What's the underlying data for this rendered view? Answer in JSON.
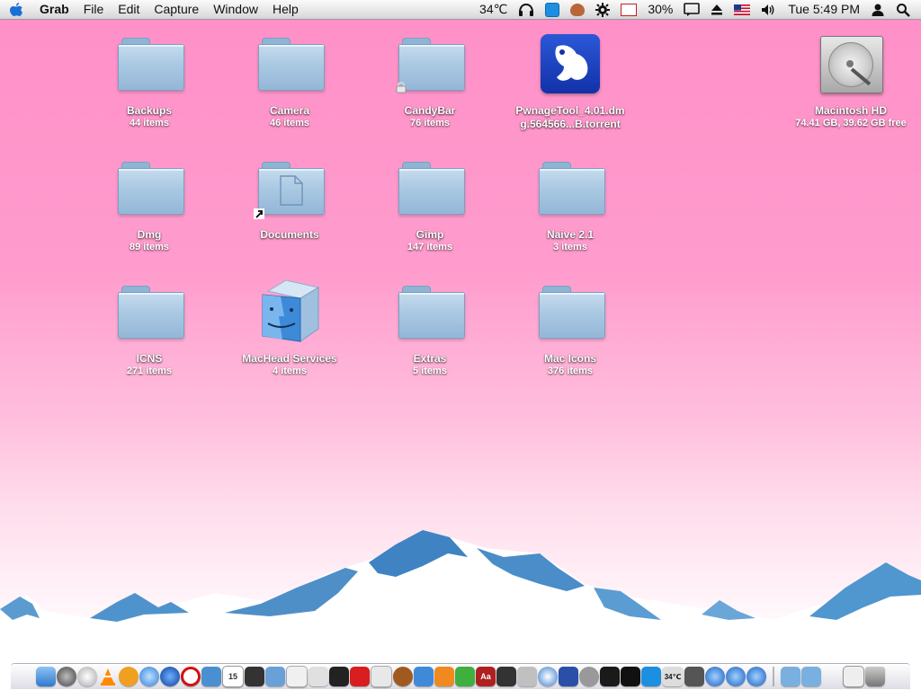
{
  "menubar": {
    "app_name": "Grab",
    "menus": [
      "File",
      "Edit",
      "Capture",
      "Window",
      "Help"
    ],
    "temperature": "34℃",
    "battery": "30%",
    "clock": "Tue 5:49 PM"
  },
  "desktop_icons": [
    {
      "label": "Backups",
      "sub": "44 items",
      "type": "folder"
    },
    {
      "label": "Camera",
      "sub": "46 items",
      "type": "folder"
    },
    {
      "label": "CandyBar",
      "sub": "76 items",
      "type": "folder-locked"
    },
    {
      "label": "PwnageTool_4.01.dm",
      "label2": "g.564566...B.torrent",
      "type": "torrent"
    },
    {
      "label": "Macintosh HD",
      "sub": "74.41 GB, 39.62 GB free",
      "type": "harddrive"
    },
    {
      "label": "Dmg",
      "sub": "89 items",
      "type": "folder"
    },
    {
      "label": "Documents",
      "type": "folder-alias"
    },
    {
      "label": "Gimp",
      "sub": "147 items",
      "type": "folder"
    },
    {
      "label": "Naive 2.1",
      "sub": "3 items",
      "type": "folder"
    },
    {
      "label": "ICNS",
      "sub": "271 items",
      "type": "folder"
    },
    {
      "label": "MacHead Services",
      "sub": "4 items",
      "type": "finder"
    },
    {
      "label": "Extras",
      "sub": "5 items",
      "type": "folder"
    },
    {
      "label": "Mac Icons",
      "sub": "376 items",
      "type": "folder"
    }
  ],
  "dock": {
    "temp_badge": "34℃",
    "calendar_day": "15",
    "dictionary_badge": "Aa"
  },
  "colors": {
    "wallpaper_top": "#ff8fc8",
    "mountain_blue": "#4f93cc",
    "folder_blue": "#a9c8e2"
  }
}
